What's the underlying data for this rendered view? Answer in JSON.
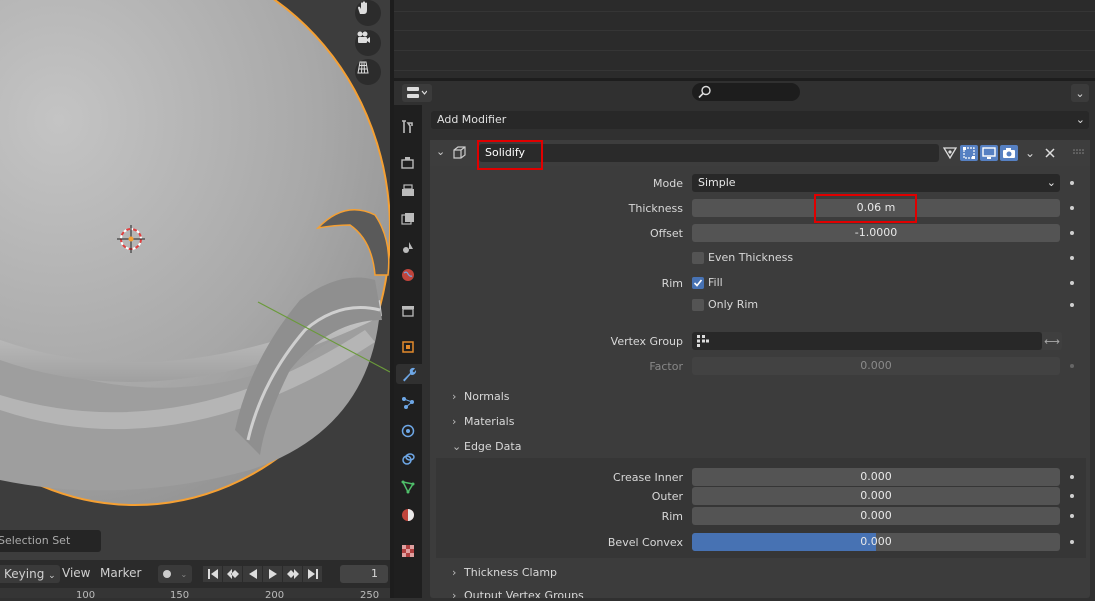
{
  "viewport": {
    "selection_set_label": "Selection Set"
  },
  "timeline": {
    "keying": "Keying",
    "view": "View",
    "marker": "Marker",
    "current_frame": "1",
    "ruler": [
      "100",
      "150",
      "200",
      "250"
    ]
  },
  "properties": {
    "add_modifier": "Add Modifier",
    "modifier": {
      "name": "Solidify",
      "mode_label": "Mode",
      "mode_value": "Simple",
      "thickness_label": "Thickness",
      "thickness_value": "0.06 m",
      "offset_label": "Offset",
      "offset_value": "-1.0000",
      "even_thickness_label": "Even Thickness",
      "even_thickness_checked": false,
      "rim_label": "Rim",
      "fill_label": "Fill",
      "fill_checked": true,
      "only_rim_label": "Only Rim",
      "only_rim_checked": false,
      "vertex_group_label": "Vertex Group",
      "vertex_group_value": "",
      "factor_label": "Factor",
      "factor_value": "0.000"
    },
    "subpanels": {
      "normals": "Normals",
      "materials": "Materials",
      "edge_data": "Edge Data",
      "thickness_clamp": "Thickness Clamp",
      "output_vertex_groups": "Output Vertex Groups"
    },
    "edge_data": {
      "crease_inner_label": "Crease Inner",
      "crease_inner_value": "0.000",
      "outer_label": "Outer",
      "outer_value": "0.000",
      "rim_label": "Rim",
      "rim_value": "0.000",
      "bevel_convex_label": "Bevel Convex",
      "bevel_convex_value": "0.000",
      "bevel_convex_fill": 0.5
    }
  },
  "colors": {
    "accent": "#4772b3",
    "selection_outline": "#f5a033",
    "highlight_box": "#e00000"
  }
}
